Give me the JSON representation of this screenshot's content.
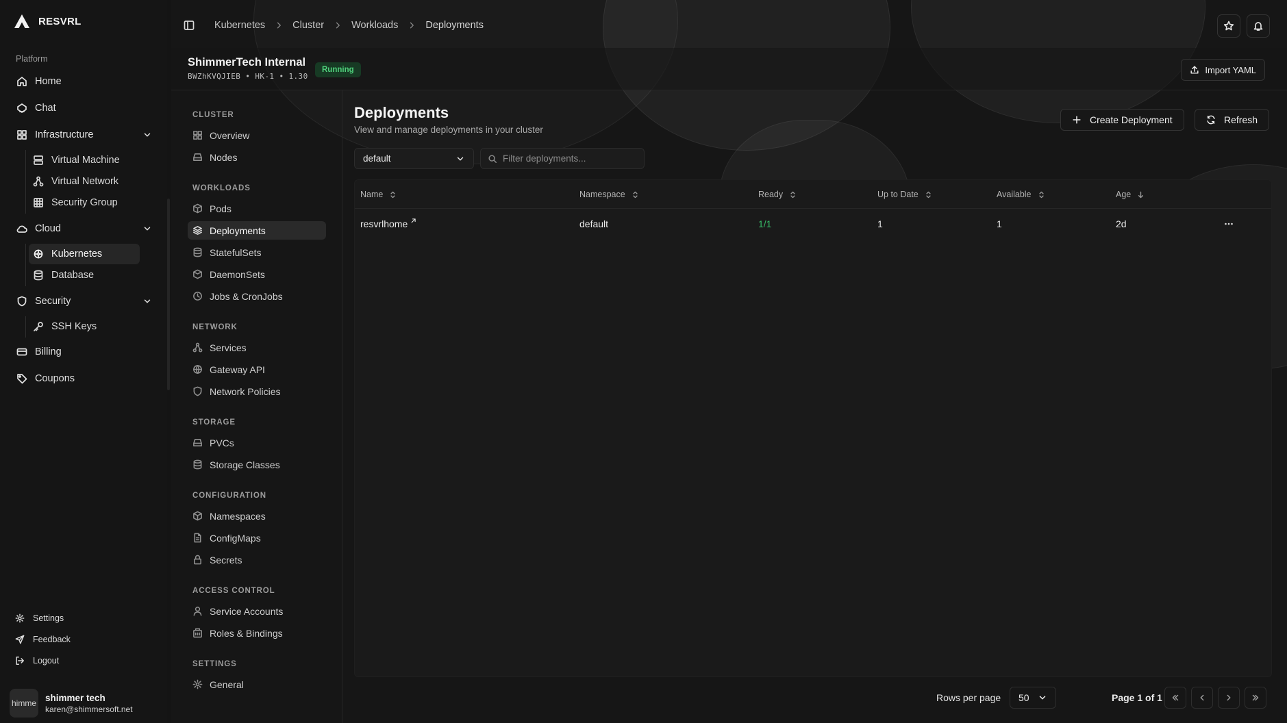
{
  "brand": {
    "name": "RESVRL"
  },
  "sidebar": {
    "group_label": "Platform",
    "home": "Home",
    "chat": "Chat",
    "infrastructure": "Infrastructure",
    "infrastructure_items": [
      "Virtual Machine",
      "Virtual Network",
      "Security Group"
    ],
    "cloud": "Cloud",
    "cloud_items": [
      "Kubernetes",
      "Database"
    ],
    "security": "Security",
    "security_items": [
      "SSH Keys"
    ],
    "billing": "Billing",
    "coupons": "Coupons",
    "footer": {
      "settings": "Settings",
      "feedback": "Feedback",
      "logout": "Logout"
    },
    "user": {
      "avatar_text": "himme",
      "name": "shimmer tech",
      "email": "karen@shimmersoft.net"
    }
  },
  "breadcrumb": [
    "Kubernetes",
    "Cluster",
    "Workloads",
    "Deployments"
  ],
  "cluster": {
    "name": "ShimmerTech Internal",
    "id": "BWZhKVQJIEB",
    "region": "HK-1",
    "version": "1.30",
    "status": "Running",
    "import_label": "Import YAML"
  },
  "cluster_nav": {
    "cluster": {
      "label": "CLUSTER",
      "items": [
        "Overview",
        "Nodes"
      ]
    },
    "workloads": {
      "label": "WORKLOADS",
      "items": [
        "Pods",
        "Deployments",
        "StatefulSets",
        "DaemonSets",
        "Jobs & CronJobs"
      ]
    },
    "network": {
      "label": "NETWORK",
      "items": [
        "Services",
        "Gateway API",
        "Network Policies"
      ]
    },
    "storage": {
      "label": "STORAGE",
      "items": [
        "PVCs",
        "Storage Classes"
      ]
    },
    "configuration": {
      "label": "CONFIGURATION",
      "items": [
        "Namespaces",
        "ConfigMaps",
        "Secrets"
      ]
    },
    "access": {
      "label": "ACCESS CONTROL",
      "items": [
        "Service Accounts",
        "Roles & Bindings"
      ]
    },
    "settings": {
      "label": "SETTINGS",
      "items": [
        "General"
      ]
    }
  },
  "page": {
    "title": "Deployments",
    "subtitle": "View and manage deployments in your cluster",
    "create_label": "Create Deployment",
    "refresh_label": "Refresh",
    "namespace": "default",
    "filter_placeholder": "Filter deployments..."
  },
  "table": {
    "columns": [
      "Name",
      "Namespace",
      "Ready",
      "Up to Date",
      "Available",
      "Age"
    ],
    "rows": [
      {
        "name": "resvrlhome",
        "namespace": "default",
        "ready": "1/1",
        "up_to_date": "1",
        "available": "1",
        "age": "2d"
      }
    ]
  },
  "pagination": {
    "rows_label": "Rows per page",
    "rows_value": "50",
    "page_info": "Page 1 of 1"
  },
  "colors": {
    "accent_green": "#37b866",
    "badge_bg": "#173a24",
    "background": "#141414"
  }
}
